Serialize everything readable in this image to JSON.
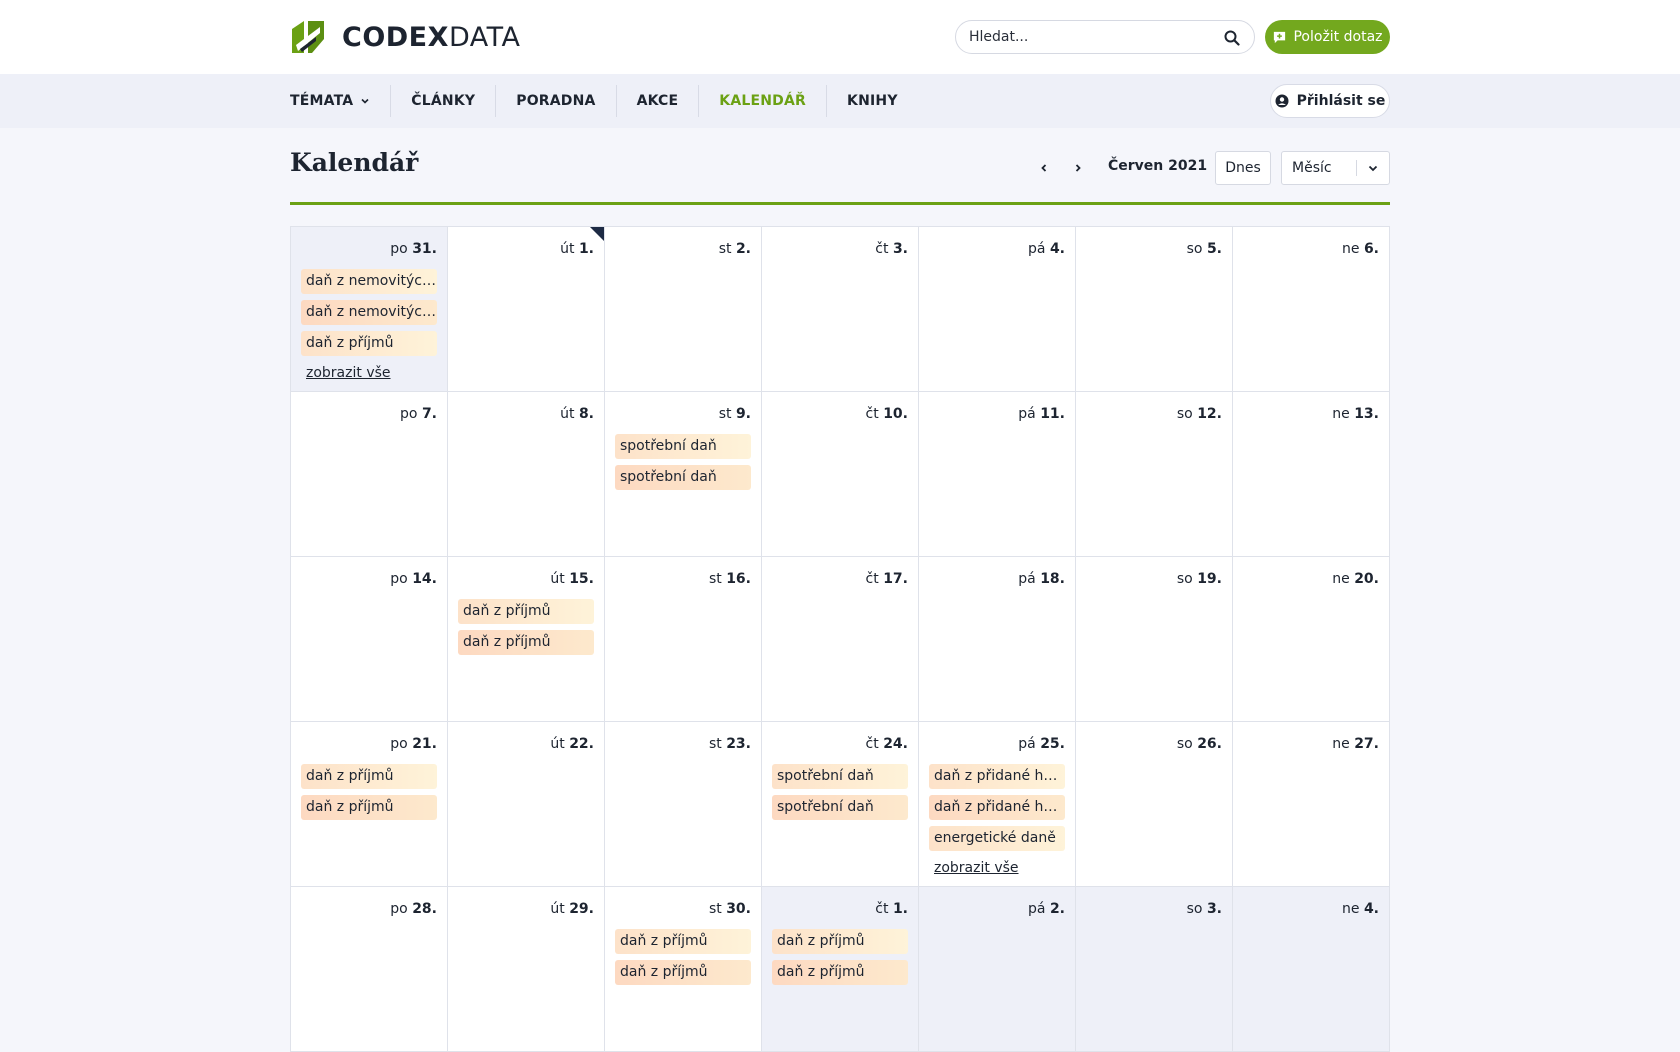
{
  "brand": {
    "name_bold": "CODEX",
    "name_light": "DATA",
    "logo_color": "#6ba114"
  },
  "search": {
    "placeholder": "Hledat..."
  },
  "header": {
    "ask_label": "Položit dotaz",
    "login_label": "Přihlásit se"
  },
  "nav": {
    "items": [
      {
        "label": "TÉMATA",
        "has_dropdown": true,
        "active": false
      },
      {
        "label": "ČLÁNKY",
        "active": false
      },
      {
        "label": "PORADNA",
        "active": false
      },
      {
        "label": "AKCE",
        "active": false
      },
      {
        "label": "KALENDÁŘ",
        "active": true
      },
      {
        "label": "KNIHY",
        "active": false
      }
    ]
  },
  "page": {
    "title": "Kalendář",
    "month_label": "Červen 2021",
    "today_label": "Dnes",
    "view_label": "Měsíc"
  },
  "colors": {
    "accent": "#6ba114",
    "event_bg": "#fde3cb",
    "other_month_bg": "#eef0f8"
  },
  "calendar": {
    "show_all_label": "zobrazit vše",
    "weeks": [
      [
        {
          "dow": "po",
          "num": "31.",
          "other": true,
          "events": [
            "daň z nemovitých věcí",
            "daň z nemovitých věcí",
            "daň z příjmů"
          ],
          "show_all": true
        },
        {
          "dow": "út",
          "num": "1.",
          "today": true,
          "events": []
        },
        {
          "dow": "st",
          "num": "2.",
          "events": []
        },
        {
          "dow": "čt",
          "num": "3.",
          "events": []
        },
        {
          "dow": "pá",
          "num": "4.",
          "events": []
        },
        {
          "dow": "so",
          "num": "5.",
          "events": []
        },
        {
          "dow": "ne",
          "num": "6.",
          "events": []
        }
      ],
      [
        {
          "dow": "po",
          "num": "7.",
          "events": []
        },
        {
          "dow": "út",
          "num": "8.",
          "events": []
        },
        {
          "dow": "st",
          "num": "9.",
          "events": [
            "spotřební daň",
            "spotřební daň"
          ]
        },
        {
          "dow": "čt",
          "num": "10.",
          "events": []
        },
        {
          "dow": "pá",
          "num": "11.",
          "events": []
        },
        {
          "dow": "so",
          "num": "12.",
          "events": []
        },
        {
          "dow": "ne",
          "num": "13.",
          "events": []
        }
      ],
      [
        {
          "dow": "po",
          "num": "14.",
          "events": []
        },
        {
          "dow": "út",
          "num": "15.",
          "events": [
            "daň z příjmů",
            "daň z příjmů"
          ]
        },
        {
          "dow": "st",
          "num": "16.",
          "events": []
        },
        {
          "dow": "čt",
          "num": "17.",
          "events": []
        },
        {
          "dow": "pá",
          "num": "18.",
          "events": []
        },
        {
          "dow": "so",
          "num": "19.",
          "events": []
        },
        {
          "dow": "ne",
          "num": "20.",
          "events": []
        }
      ],
      [
        {
          "dow": "po",
          "num": "21.",
          "events": [
            "daň z příjmů",
            "daň z příjmů"
          ]
        },
        {
          "dow": "út",
          "num": "22.",
          "events": []
        },
        {
          "dow": "st",
          "num": "23.",
          "events": []
        },
        {
          "dow": "čt",
          "num": "24.",
          "events": [
            "spotřební daň",
            "spotřební daň"
          ]
        },
        {
          "dow": "pá",
          "num": "25.",
          "events": [
            "daň z přidané hodnoty",
            "daň z přidané hodnoty",
            "energetické daně"
          ],
          "show_all": true
        },
        {
          "dow": "so",
          "num": "26.",
          "events": []
        },
        {
          "dow": "ne",
          "num": "27.",
          "events": []
        }
      ],
      [
        {
          "dow": "po",
          "num": "28.",
          "events": []
        },
        {
          "dow": "út",
          "num": "29.",
          "events": []
        },
        {
          "dow": "st",
          "num": "30.",
          "events": [
            "daň z příjmů",
            "daň z příjmů"
          ]
        },
        {
          "dow": "čt",
          "num": "1.",
          "other": true,
          "events": [
            "daň z příjmů",
            "daň z příjmů"
          ]
        },
        {
          "dow": "pá",
          "num": "2.",
          "other": true,
          "events": []
        },
        {
          "dow": "so",
          "num": "3.",
          "other": true,
          "events": []
        },
        {
          "dow": "ne",
          "num": "4.",
          "other": true,
          "events": []
        }
      ]
    ]
  }
}
